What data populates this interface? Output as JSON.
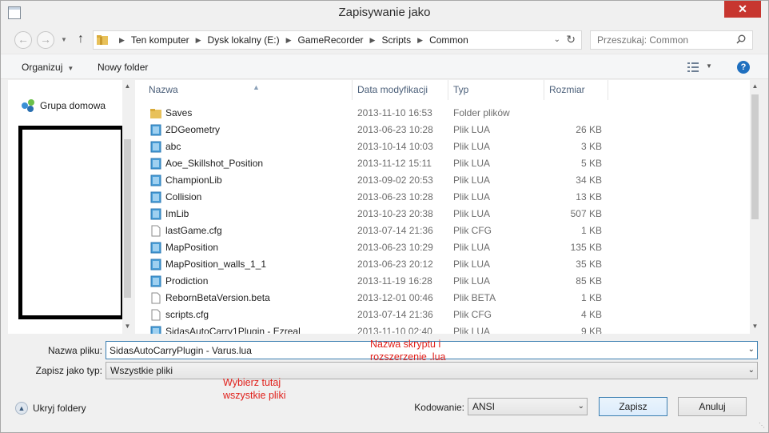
{
  "window": {
    "title": "Zapisywanie jako",
    "close_label": "✕"
  },
  "nav": {
    "back_icon": "back-arrow-icon",
    "forward_icon": "forward-arrow-icon",
    "up_icon": "up-arrow-icon",
    "breadcrumbs": [
      "Ten komputer",
      "Dysk lokalny (E:)",
      "GameRecorder",
      "Scripts",
      "Common"
    ],
    "search_placeholder": "Przeszukaj: Common"
  },
  "toolbar": {
    "organize_label": "Organizuj",
    "new_folder_label": "Nowy folder",
    "help_label": "?"
  },
  "sidebar": {
    "homegroup_label": "Grupa domowa"
  },
  "columns": {
    "name": "Nazwa",
    "date": "Data modyfikacji",
    "type": "Typ",
    "size": "Rozmiar"
  },
  "files": [
    {
      "name": "Saves",
      "date": "2013-11-10 16:53",
      "type": "Folder plików",
      "size": "",
      "icon": "folder-icon"
    },
    {
      "name": "2DGeometry",
      "date": "2013-06-23 10:28",
      "type": "Plik LUA",
      "size": "26 KB",
      "icon": "lua-file-icon"
    },
    {
      "name": "abc",
      "date": "2013-10-14 10:03",
      "type": "Plik LUA",
      "size": "3 KB",
      "icon": "lua-file-icon"
    },
    {
      "name": "Aoe_Skillshot_Position",
      "date": "2013-11-12 15:11",
      "type": "Plik LUA",
      "size": "5 KB",
      "icon": "lua-file-icon"
    },
    {
      "name": "ChampionLib",
      "date": "2013-09-02 20:53",
      "type": "Plik LUA",
      "size": "34 KB",
      "icon": "lua-file-icon"
    },
    {
      "name": "Collision",
      "date": "2013-06-23 10:28",
      "type": "Plik LUA",
      "size": "13 KB",
      "icon": "lua-file-icon"
    },
    {
      "name": "ImLib",
      "date": "2013-10-23 20:38",
      "type": "Plik LUA",
      "size": "507 KB",
      "icon": "lua-file-icon"
    },
    {
      "name": "lastGame.cfg",
      "date": "2013-07-14 21:36",
      "type": "Plik CFG",
      "size": "1 KB",
      "icon": "text-file-icon"
    },
    {
      "name": "MapPosition",
      "date": "2013-06-23 10:29",
      "type": "Plik LUA",
      "size": "135 KB",
      "icon": "lua-file-icon"
    },
    {
      "name": "MapPosition_walls_1_1",
      "date": "2013-06-23 20:12",
      "type": "Plik LUA",
      "size": "35 KB",
      "icon": "lua-file-icon"
    },
    {
      "name": "Prodiction",
      "date": "2013-11-19 16:28",
      "type": "Plik LUA",
      "size": "85 KB",
      "icon": "lua-file-icon"
    },
    {
      "name": "RebornBetaVersion.beta",
      "date": "2013-12-01 00:46",
      "type": "Plik BETA",
      "size": "1 KB",
      "icon": "text-file-icon"
    },
    {
      "name": "scripts.cfg",
      "date": "2013-07-14 21:36",
      "type": "Plik CFG",
      "size": "4 KB",
      "icon": "text-file-icon"
    },
    {
      "name": "SidasAutoCarry1Plugin - Ezreal",
      "date": "2013-11-10 02:40",
      "type": "Plik LUA",
      "size": "9 KB",
      "icon": "lua-file-icon"
    }
  ],
  "form": {
    "filename_label": "Nazwa pliku:",
    "filename_value": "SidasAutoCarryPlugin - Varus.lua",
    "filetype_label": "Zapisz jako typ:",
    "filetype_value": "Wszystkie pliki",
    "encoding_label": "Kodowanie:",
    "encoding_value": "ANSI",
    "hide_folders_label": "Ukryj foldery",
    "save_label": "Zapisz",
    "cancel_label": "Anuluj"
  },
  "annotations": {
    "filename_note": [
      "Nazwa skryptu i",
      "rozszerzenie .lua"
    ],
    "filetype_note": [
      "Wybierz tutaj",
      "wszystkie pliki"
    ]
  },
  "colors": {
    "annotation": "#e0201b",
    "close_button": "#c7362f",
    "lua_icon": "#4a9fd8",
    "folder": "#e8c15a"
  }
}
